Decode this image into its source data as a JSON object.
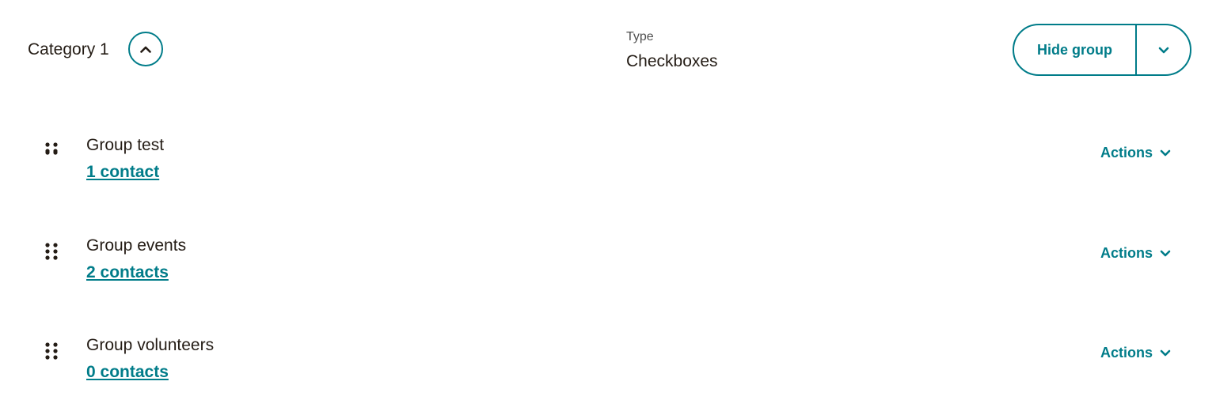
{
  "category": {
    "title": "Category 1",
    "toggle_icon": "chevron-up-icon"
  },
  "type": {
    "label": "Type",
    "value": "Checkboxes"
  },
  "hide_group": {
    "label": "Hide group",
    "menu_icon": "chevron-down-icon"
  },
  "groups": [
    {
      "name": "Group test",
      "contacts": "1 contact",
      "actions_label": "Actions"
    },
    {
      "name": "Group events",
      "contacts": "2 contacts",
      "actions_label": "Actions"
    },
    {
      "name": "Group volunteers",
      "contacts": "0 contacts",
      "actions_label": "Actions"
    }
  ],
  "colors": {
    "accent": "#007c89",
    "text": "#241c15",
    "muted": "#4f4f4f"
  }
}
